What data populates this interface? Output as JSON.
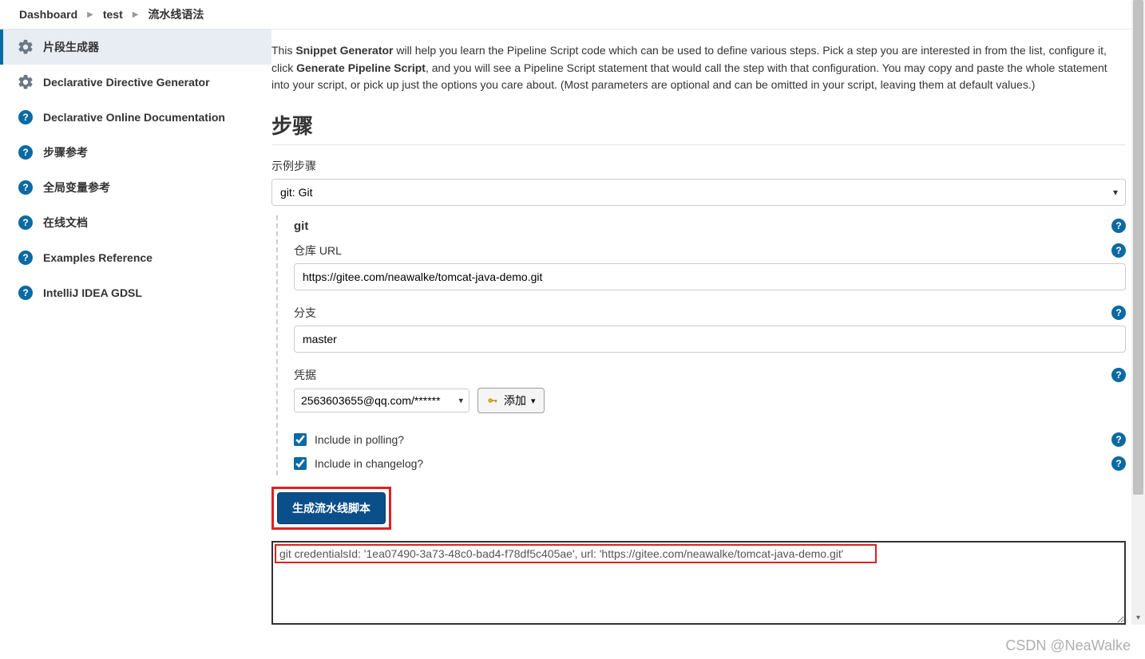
{
  "breadcrumb": {
    "items": [
      "Dashboard",
      "test",
      "流水线语法"
    ]
  },
  "sidebar": {
    "items": [
      {
        "label": "片段生成器",
        "icon": "gear",
        "active": true
      },
      {
        "label": "Declarative Directive Generator",
        "icon": "gear",
        "active": false
      },
      {
        "label": "Declarative Online Documentation",
        "icon": "help",
        "active": false
      },
      {
        "label": "步骤参考",
        "icon": "help",
        "active": false
      },
      {
        "label": "全局变量参考",
        "icon": "help",
        "active": false
      },
      {
        "label": "在线文档",
        "icon": "help",
        "active": false
      },
      {
        "label": "Examples Reference",
        "icon": "help",
        "active": false
      },
      {
        "label": "IntelliJ IDEA GDSL",
        "icon": "help",
        "active": false
      }
    ]
  },
  "intro": {
    "prefix": "This ",
    "bold1": "Snippet Generator",
    "mid1": " will help you learn the Pipeline Script code which can be used to define various steps. Pick a step you are interested in from the list, configure it, click ",
    "bold2": "Generate Pipeline Script",
    "suffix": ", and you will see a Pipeline Script statement that would call the step with that configuration. You may copy and paste the whole statement into your script, or pick up just the options you care about. (Most parameters are optional and can be omitted in your script, leaving them at default values.)"
  },
  "section_title": "步骤",
  "sample_step_label": "示例步骤",
  "step_select_value": "git: Git",
  "step_name": "git",
  "fields": {
    "repo_url": {
      "label": "仓库 URL",
      "value": "https://gitee.com/neawalke/tomcat-java-demo.git"
    },
    "branch": {
      "label": "分支",
      "value": "master"
    },
    "credentials": {
      "label": "凭据",
      "value": "2563603655@qq.com/******",
      "add_label": "添加"
    },
    "poll": {
      "label": "Include in polling?",
      "checked": true
    },
    "changelog": {
      "label": "Include in changelog?",
      "checked": true
    }
  },
  "generate_button": "生成流水线脚本",
  "output": "git credentialsId: '1ea07490-3a73-48c0-bad4-f78df5c405ae', url: 'https://gitee.com/neawalke/tomcat-java-demo.git'",
  "watermark": "CSDN @NeaWalke"
}
